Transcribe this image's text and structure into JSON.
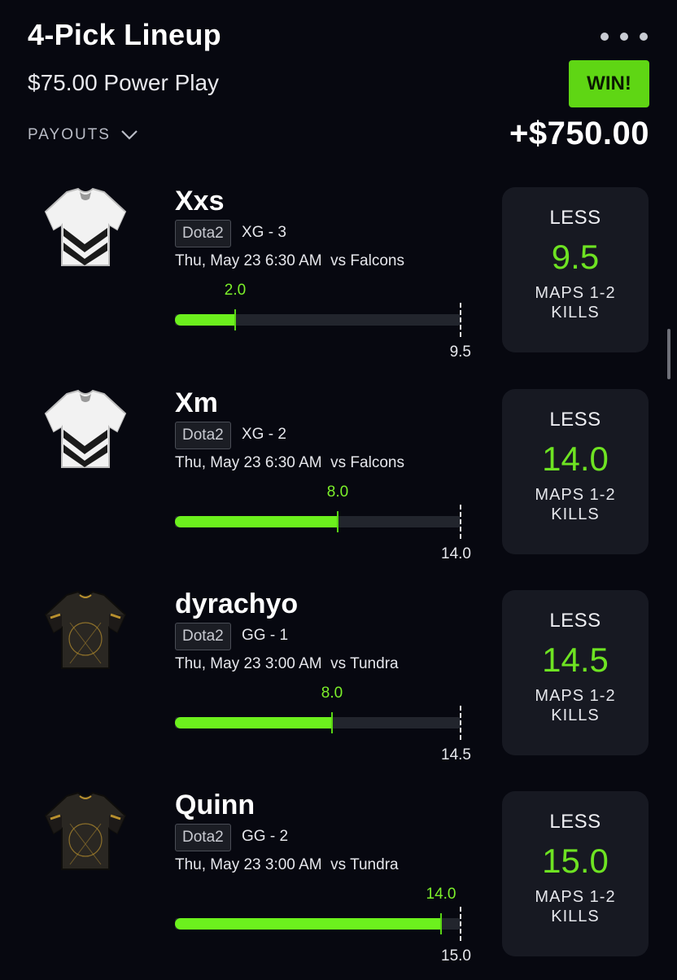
{
  "header": {
    "title": "4-Pick Lineup",
    "subtitle": "$75.00 Power Play",
    "payouts_label": "PAYOUTS",
    "status": "WIN!",
    "payout": "+$750.00"
  },
  "colors": {
    "accent_green": "#6cf01d",
    "win_badge": "#5fd614",
    "background": "#070810",
    "card": "#171922"
  },
  "picks": [
    {
      "name": "Xxs",
      "game_tag": "Dota2",
      "team": "XG - 3",
      "game_info": "Thu, May 23 6:30 AM  vs Falcons",
      "actual": 2.0,
      "actual_label": "2.0",
      "line": 9.5,
      "line_label": "9.5",
      "direction": "LESS",
      "value": "9.5",
      "stat_line1": "MAPS 1-2",
      "stat_line2": "KILLS",
      "jersey": "white-jersey-icon"
    },
    {
      "name": "Xm",
      "game_tag": "Dota2",
      "team": "XG - 2",
      "game_info": "Thu, May 23 6:30 AM  vs Falcons",
      "actual": 8.0,
      "actual_label": "8.0",
      "line": 14.0,
      "line_label": "14.0",
      "direction": "LESS",
      "value": "14.0",
      "stat_line1": "MAPS 1-2",
      "stat_line2": "KILLS",
      "jersey": "white-jersey-icon"
    },
    {
      "name": "dyrachyo",
      "game_tag": "Dota2",
      "team": "GG - 1",
      "game_info": "Thu, May 23 3:00 AM  vs Tundra",
      "actual": 8.0,
      "actual_label": "8.0",
      "line": 14.5,
      "line_label": "14.5",
      "direction": "LESS",
      "value": "14.5",
      "stat_line1": "MAPS 1-2",
      "stat_line2": "KILLS",
      "jersey": "black-gold-jersey-icon"
    },
    {
      "name": "Quinn",
      "game_tag": "Dota2",
      "team": "GG - 2",
      "game_info": "Thu, May 23 3:00 AM  vs Tundra",
      "actual": 14.0,
      "actual_label": "14.0",
      "line": 15.0,
      "line_label": "15.0",
      "direction": "LESS",
      "value": "15.0",
      "stat_line1": "MAPS 1-2",
      "stat_line2": "KILLS",
      "jersey": "black-gold-jersey-icon"
    }
  ]
}
